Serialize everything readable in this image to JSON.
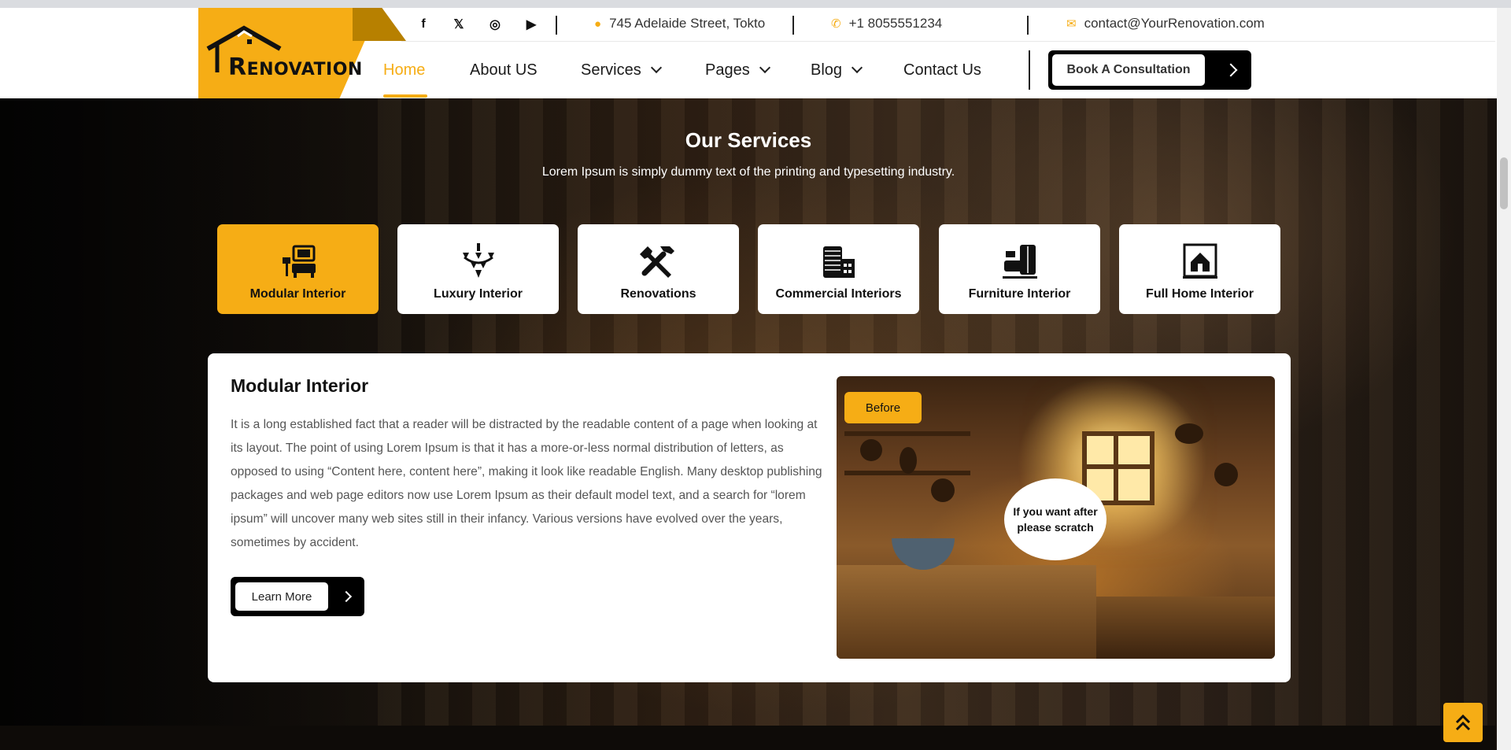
{
  "header": {
    "logo_letter": "R",
    "logo_text": "ENOVATION",
    "topbar": {
      "social": [
        "f",
        "𝕏",
        "◎",
        "▶"
      ],
      "address": "745 Adelaide Street, Tokto",
      "phone": "+1 8055551234",
      "email": "contact@YourRenovation.com"
    },
    "nav": {
      "home": "Home",
      "about": "About US",
      "services": "Services",
      "pages": "Pages",
      "blog": "Blog",
      "contact": "Contact Us"
    },
    "cta_label": "Book A Consultation"
  },
  "services": {
    "title": "Our Services",
    "subtitle": "Lorem Ipsum is simply dummy text of the printing and typesetting industry.",
    "tabs": [
      {
        "label": "Modular Interior",
        "icon": "modular-interior-icon",
        "active": true
      },
      {
        "label": "Luxury Interior",
        "icon": "chandelier-icon"
      },
      {
        "label": "Renovations",
        "icon": "tools-icon"
      },
      {
        "label": "Commercial Interiors",
        "icon": "building-icon"
      },
      {
        "label": "Furniture Interior",
        "icon": "furniture-icon"
      },
      {
        "label": "Full Home Interior",
        "icon": "home-icon"
      }
    ]
  },
  "detail": {
    "title": "Modular Interior",
    "body": "It is a long established fact that a reader will be distracted by the readable content of a page when looking at its layout. The point of using Lorem Ipsum is that it has a more-or-less normal distribution of letters, as opposed to using “Content here, content here”, making it look like readable English. Many desktop publishing packages and web page editors now use Lorem Ipsum as their default model text, and a search for “lorem ipsum” will uncover many web sites still in their infancy. Various versions have evolved over the years, sometimes by accident.",
    "learn_more": "Learn More",
    "before_badge": "Before",
    "scratch_hint": "If you want after please scratch"
  },
  "colors": {
    "accent": "#f6ad15",
    "dark": "#000000"
  }
}
